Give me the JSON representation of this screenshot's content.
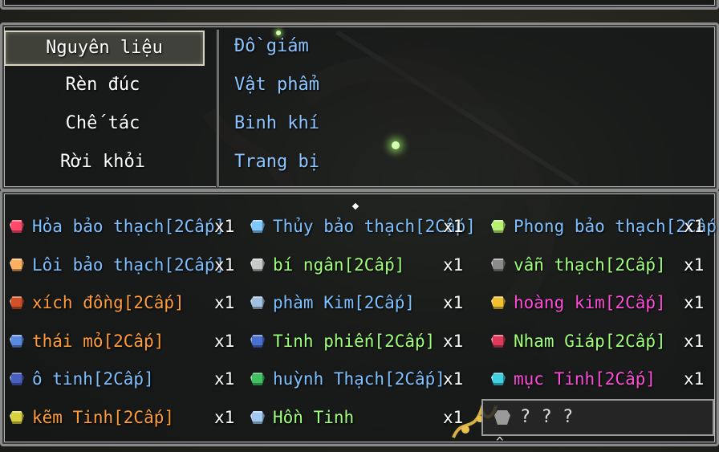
{
  "menu": {
    "commands": [
      {
        "label": "Nguyên liệu",
        "selected": true
      },
      {
        "label": "Rèn đúc",
        "selected": false
      },
      {
        "label": "Chế tác",
        "selected": false
      },
      {
        "label": "Rời khỏi",
        "selected": false
      }
    ],
    "categories": [
      {
        "label": "Đồ giám"
      },
      {
        "label": "Vật phẩm"
      },
      {
        "label": "Binh khí"
      },
      {
        "label": "Trang bị"
      }
    ]
  },
  "items": [
    {
      "name": "Hỏa bảo thạch[2Cấp]",
      "qty": "x1",
      "color": "#7ec0ff",
      "gem": "#ff4a6a"
    },
    {
      "name": "Thủy bảo thạch[2Cấp]",
      "qty": "x1",
      "color": "#7ec0ff",
      "gem": "#7ec8ff"
    },
    {
      "name": "Phong bảo thạch[2Cấp]",
      "qty": "x1",
      "color": "#7ec0ff",
      "gem": "#b8f070"
    },
    {
      "name": "Lôi bảo thạch[2Cấp]",
      "qty": "x1",
      "color": "#7ec0ff",
      "gem": "#ffb060"
    },
    {
      "name": "bí ngân[2Cấp]",
      "qty": "x1",
      "color": "#9fff7a",
      "gem": "#c8c8c8"
    },
    {
      "name": "vẫn thạch[2Cấp]",
      "qty": "x1",
      "color": "#9fff7a",
      "gem": "#8a8a8a"
    },
    {
      "name": "xích đồng[2Cấp]",
      "qty": "x1",
      "color": "#ff9c3a",
      "gem": "#d0502a"
    },
    {
      "name": "phàm Kim[2Cấp]",
      "qty": "x1",
      "color": "#7ec0ff",
      "gem": "#a0c0e0"
    },
    {
      "name": "hoàng kim[2Cấp]",
      "qty": "x1",
      "color": "#ff4cd8",
      "gem": "#f0c030"
    },
    {
      "name": "thái mỏ[2Cấp]",
      "qty": "x1",
      "color": "#ff9c3a",
      "gem": "#5a8ae0"
    },
    {
      "name": "Tinh phiến[2Cấp]",
      "qty": "x1",
      "color": "#9fff7a",
      "gem": "#4a70d0"
    },
    {
      "name": "Nham Giáp[2Cấp]",
      "qty": "x1",
      "color": "#9fff7a",
      "gem": "#e03a5a"
    },
    {
      "name": "ô tinh[2Cấp]",
      "qty": "x1",
      "color": "#7ec0ff",
      "gem": "#4a60c0"
    },
    {
      "name": "huỳnh Thạch[2Cấp]",
      "qty": "x1",
      "color": "#7ec0ff",
      "gem": "#40c060"
    },
    {
      "name": "mục Tinh[2Cấp]",
      "qty": "x1",
      "color": "#ff4cd8",
      "gem": "#40d0e0"
    },
    {
      "name": "kẽm Tinh[2Cấp]",
      "qty": "x1",
      "color": "#ff9c3a",
      "gem": "#d8d040"
    },
    {
      "name": "Hồn Tinh",
      "qty": "x1",
      "color": "#9fff7a",
      "gem": "#a0c8f0"
    }
  ],
  "popup": {
    "text": "? ? ?"
  }
}
